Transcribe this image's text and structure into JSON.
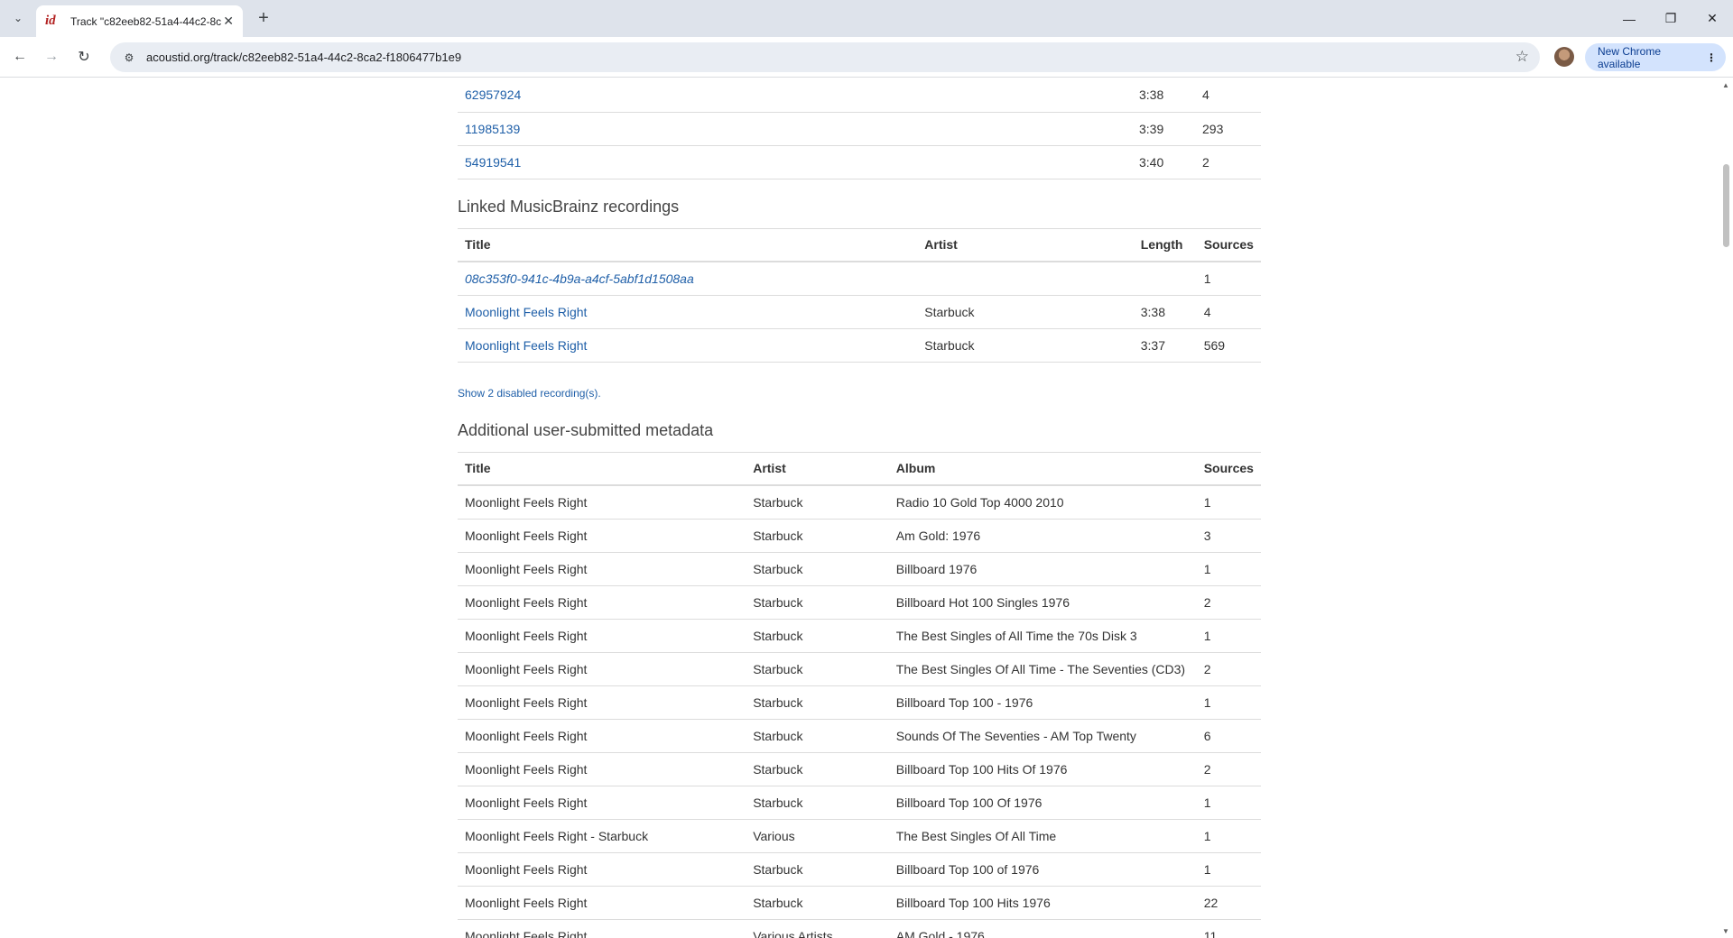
{
  "browser": {
    "tab_title": "Track \"c82eeb82-51a4-44c2-8c",
    "tab_favicon": "id",
    "url": "acoustid.org/track/c82eeb82-51a4-44c2-8ca2-f1806477b1e9",
    "update_label": "New Chrome available"
  },
  "fingerprints": [
    {
      "id": "62957924",
      "length": "3:38",
      "sources": "4"
    },
    {
      "id": "11985139",
      "length": "3:39",
      "sources": "293"
    },
    {
      "id": "54919541",
      "length": "3:40",
      "sources": "2"
    }
  ],
  "recordings": {
    "heading": "Linked MusicBrainz recordings",
    "columns": {
      "title": "Title",
      "artist": "Artist",
      "length": "Length",
      "sources": "Sources"
    },
    "rows": [
      {
        "title": "08c353f0-941c-4b9a-a4cf-5abf1d1508aa",
        "artist": "",
        "length": "",
        "sources": "1"
      },
      {
        "title": "Moonlight Feels Right",
        "artist": "Starbuck",
        "length": "3:38",
        "sources": "4"
      },
      {
        "title": "Moonlight Feels Right",
        "artist": "Starbuck",
        "length": "3:37",
        "sources": "569"
      }
    ],
    "show_disabled": "Show 2 disabled recording(s)."
  },
  "metadata": {
    "heading": "Additional user-submitted metadata",
    "columns": {
      "title": "Title",
      "artist": "Artist",
      "album": "Album",
      "sources": "Sources"
    },
    "rows": [
      {
        "title": "Moonlight Feels Right",
        "artist": "Starbuck",
        "album": "Radio 10 Gold Top 4000 2010",
        "sources": "1"
      },
      {
        "title": "Moonlight Feels Right",
        "artist": "Starbuck",
        "album": "Am Gold: 1976",
        "sources": "3"
      },
      {
        "title": "Moonlight Feels Right",
        "artist": "Starbuck",
        "album": "Billboard 1976",
        "sources": "1"
      },
      {
        "title": "Moonlight Feels Right",
        "artist": "Starbuck",
        "album": "Billboard Hot 100 Singles 1976",
        "sources": "2"
      },
      {
        "title": "Moonlight Feels Right",
        "artist": "Starbuck",
        "album": "The Best Singles of All Time the 70s Disk 3",
        "sources": "1"
      },
      {
        "title": "Moonlight Feels Right",
        "artist": "Starbuck",
        "album": "The Best Singles Of All Time - The Seventies (CD3)",
        "sources": "2"
      },
      {
        "title": "Moonlight Feels Right",
        "artist": "Starbuck",
        "album": "Billboard Top 100 - 1976",
        "sources": "1"
      },
      {
        "title": "Moonlight Feels Right",
        "artist": "Starbuck",
        "album": "Sounds Of The Seventies - AM Top Twenty",
        "sources": "6"
      },
      {
        "title": "Moonlight Feels Right",
        "artist": "Starbuck",
        "album": "Billboard Top 100 Hits Of 1976",
        "sources": "2"
      },
      {
        "title": "Moonlight Feels Right",
        "artist": "Starbuck",
        "album": "Billboard Top 100 Of 1976",
        "sources": "1"
      },
      {
        "title": "Moonlight Feels Right - Starbuck",
        "artist": "Various",
        "album": "The Best Singles Of All Time",
        "sources": "1"
      },
      {
        "title": "Moonlight Feels Right",
        "artist": "Starbuck",
        "album": "Billboard Top 100 of 1976",
        "sources": "1"
      },
      {
        "title": "Moonlight Feels Right",
        "artist": "Starbuck",
        "album": "Billboard Top 100 Hits 1976",
        "sources": "22"
      },
      {
        "title": "Moonlight Feels Right",
        "artist": "Various Artists",
        "album": "AM Gold - 1976",
        "sources": "11"
      }
    ]
  }
}
